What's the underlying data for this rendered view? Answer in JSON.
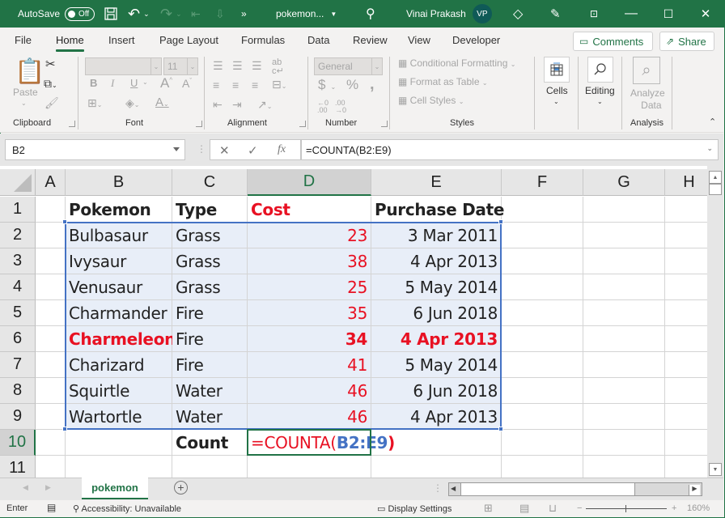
{
  "titlebar": {
    "autosave_label": "AutoSave",
    "autosave_state": "Off",
    "more_label": "»",
    "filename": "pokemon...",
    "user_name": "Vinai Prakash",
    "user_initials": "VP"
  },
  "tabs": [
    {
      "label": "File"
    },
    {
      "label": "Home",
      "active": true
    },
    {
      "label": "Insert"
    },
    {
      "label": "Page Layout"
    },
    {
      "label": "Formulas"
    },
    {
      "label": "Data"
    },
    {
      "label": "Review"
    },
    {
      "label": "View"
    },
    {
      "label": "Developer"
    }
  ],
  "actions": {
    "comments": "Comments",
    "share": "Share"
  },
  "ribbon": {
    "clipboard": {
      "paste": "Paste",
      "label": "Clipboard"
    },
    "font": {
      "name": "",
      "size": "11",
      "label": "Font",
      "bold": "B",
      "italic": "I",
      "underline": "U"
    },
    "alignment": {
      "label": "Alignment"
    },
    "number": {
      "format": "General",
      "currency": "$",
      "percent": "%",
      "comma": ",",
      "label": "Number"
    },
    "styles": {
      "conditional": "Conditional Formatting",
      "format_table": "Format as Table",
      "cell_styles": "Cell Styles",
      "label": "Styles"
    },
    "cells": {
      "label": "Cells"
    },
    "editing": {
      "label": "Editing"
    },
    "analysis": {
      "analyze_line1": "Analyze",
      "analyze_line2": "Data",
      "label": "Analysis"
    }
  },
  "formula_bar": {
    "name_box": "B2",
    "cancel": "✕",
    "enter": "✓",
    "fx": "fx",
    "formula": "=COUNTA(B2:E9)"
  },
  "columns": [
    "A",
    "B",
    "C",
    "D",
    "E",
    "F",
    "G",
    "H"
  ],
  "rows": [
    "1",
    "2",
    "3",
    "4",
    "5",
    "6",
    "7",
    "8",
    "9",
    "10",
    "11"
  ],
  "sheet": {
    "headers": {
      "pokemon": "Pokemon",
      "type": "Type",
      "cost": "Cost",
      "date": "Purchase Date"
    },
    "data": [
      {
        "pokemon": "Bulbasaur",
        "type": "Grass",
        "cost": "23",
        "date": "3 Mar 2011"
      },
      {
        "pokemon": "Ivysaur",
        "type": "Grass",
        "cost": "38",
        "date": "4 Apr 2013"
      },
      {
        "pokemon": "Venusaur",
        "type": "Grass",
        "cost": "25",
        "date": "5 May 2014"
      },
      {
        "pokemon": "Charmander",
        "type": "Fire",
        "cost": "35",
        "date": "6 Jun 2018"
      },
      {
        "pokemon": "Charmeleon",
        "type": "Fire",
        "cost": "34",
        "date": "4 Apr 2013",
        "highlight": true
      },
      {
        "pokemon": "Charizard",
        "type": "Fire",
        "cost": "41",
        "date": "5 May 2014"
      },
      {
        "pokemon": "Squirtle",
        "type": "Water",
        "cost": "46",
        "date": "6 Jun 2018"
      },
      {
        "pokemon": "Wartortle",
        "type": "Water",
        "cost": "46",
        "date": "4 Apr 2013"
      }
    ],
    "count_label": "Count",
    "edit_formula_prefix": "=COUNTA(",
    "edit_formula_ref": "B2:E9",
    "edit_formula_suffix": ")"
  },
  "sheet_tabs": [
    {
      "label": "pokemon",
      "active": true
    }
  ],
  "status": {
    "mode": "Enter",
    "accessibility": "Accessibility: Unavailable",
    "display_settings": "Display Settings",
    "zoom": "160%"
  },
  "colors": {
    "brand": "#217346",
    "red_text": "#e81123",
    "range_blue": "#4472c4",
    "range_fill": "#e8eef8"
  }
}
